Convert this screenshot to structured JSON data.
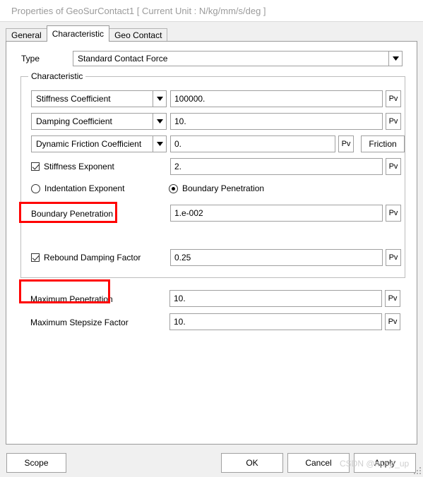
{
  "window": {
    "title": "Properties of GeoSurContact1 [ Current Unit : N/kg/mm/s/deg ]"
  },
  "tabs": [
    {
      "label": "General",
      "active": false
    },
    {
      "label": "Characteristic",
      "active": true
    },
    {
      "label": "Geo Contact",
      "active": false
    }
  ],
  "type_row": {
    "label": "Type",
    "value": "Standard Contact Force"
  },
  "characteristic": {
    "group_title": "Characteristic",
    "rows": [
      {
        "control": "combo",
        "name": "Stiffness Coefficient",
        "value": "100000.",
        "pv": "Pv"
      },
      {
        "control": "combo",
        "name": "Damping Coefficient",
        "value": "10.",
        "pv": "Pv"
      },
      {
        "control": "combo",
        "name": "Dynamic Friction Coefficient",
        "value": "0.",
        "pv": "Pv",
        "extra_button": "Friction"
      },
      {
        "control": "checkbox",
        "name": "Stiffness Exponent",
        "checked": true,
        "value": "2.",
        "pv": "Pv"
      }
    ],
    "exponent_choice": {
      "indentation": {
        "label": "Indentation Exponent",
        "selected": false
      },
      "boundary": {
        "label": "Boundary Penetration",
        "selected": true
      }
    },
    "boundary_penetration": {
      "label": "Boundary Penetration",
      "value": "1.e-002",
      "pv": "Pv",
      "highlighted": true
    },
    "rebound": {
      "label": "Rebound Damping Factor",
      "checked": true,
      "value": "0.25",
      "pv": "Pv"
    }
  },
  "bottom_fields": [
    {
      "label": "Maximum Penetration",
      "value": "10.",
      "pv": "Pv",
      "highlighted": true
    },
    {
      "label": "Maximum Stepsize Factor",
      "value": "10.",
      "pv": "Pv",
      "highlighted": false
    }
  ],
  "buttons": {
    "scope": "Scope",
    "ok": "OK",
    "cancel": "Cancel",
    "apply": "Apply"
  },
  "watermark": "CSDN @hanyi_up",
  "colors": {
    "highlight": "#ff0000",
    "dialog_bg": "#f0f0f0",
    "panel_bg": "#ffffff",
    "title_text": "#9b9b9b"
  }
}
